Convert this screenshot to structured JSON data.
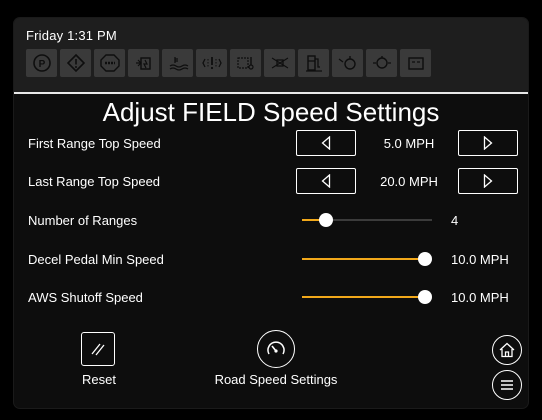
{
  "status": {
    "time": "Friday 1:31 PM",
    "indicators": [
      "parking-brake-icon",
      "warning-icon",
      "stop-icon",
      "hydraulic-filter-icon",
      "coolant-level-icon",
      "transmission-warning-icon",
      "transmission-temp-icon",
      "fuel-filter-icon",
      "fuel-level-icon",
      "engine-oil-icon",
      "oil-pressure-icon",
      "battery-icon"
    ]
  },
  "page": {
    "title": "Adjust FIELD Speed Settings"
  },
  "settings": {
    "first_range": {
      "label": "First Range Top Speed",
      "value": "5.0 MPH"
    },
    "last_range": {
      "label": "Last Range Top Speed",
      "value": "20.0 MPH"
    },
    "num_ranges": {
      "label": "Number of Ranges",
      "value": "4",
      "fraction": 0.15
    },
    "decel_pedal": {
      "label": "Decel Pedal Min Speed",
      "value": "10.0 MPH",
      "fraction": 1.0
    },
    "aws_shutoff": {
      "label": "AWS Shutoff Speed",
      "value": "10.0 MPH",
      "fraction": 1.0
    }
  },
  "actions": {
    "reset_label": "Reset",
    "road_label": "Road Speed Settings"
  },
  "colors": {
    "accent": "#f1a81a",
    "indicator_bg": "#3a3a3a",
    "status_bg": "#1e1e1e"
  }
}
